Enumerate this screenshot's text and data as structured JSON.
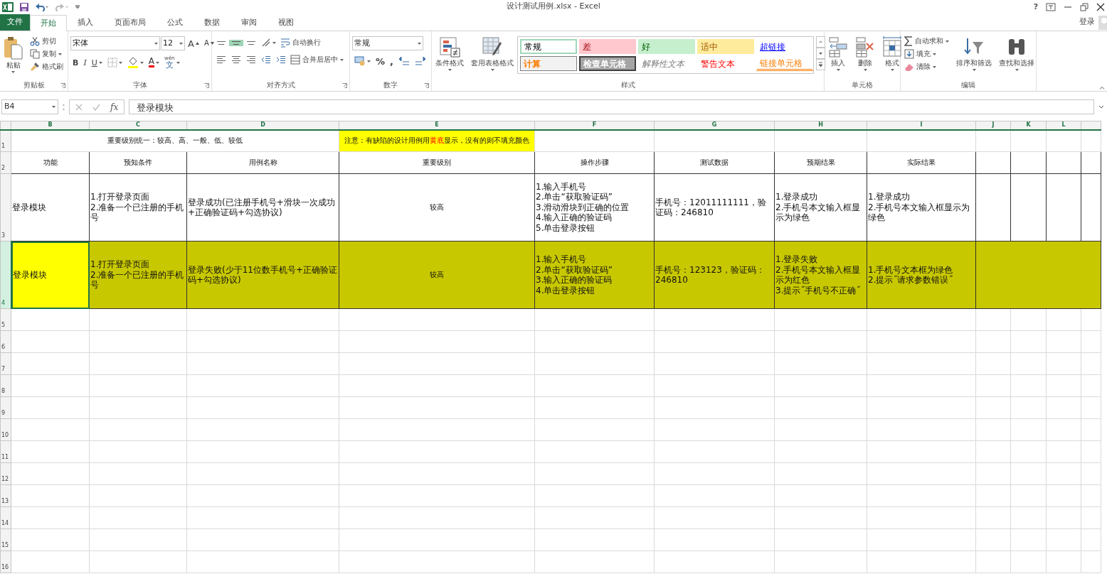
{
  "window": {
    "title": "设计测试用例.xlsx - Excel",
    "help": "?",
    "login": "登录"
  },
  "ribbon_tabs": [
    {
      "label": "文件",
      "kind": "file",
      "selected": false
    },
    {
      "label": "开始",
      "kind": "tab",
      "selected": true
    },
    {
      "label": "插入",
      "kind": "tab",
      "selected": false
    },
    {
      "label": "页面布局",
      "kind": "tab",
      "selected": false
    },
    {
      "label": "公式",
      "kind": "tab",
      "selected": false
    },
    {
      "label": "数据",
      "kind": "tab",
      "selected": false
    },
    {
      "label": "审阅",
      "kind": "tab",
      "selected": false
    },
    {
      "label": "视图",
      "kind": "tab",
      "selected": false
    }
  ],
  "ribbon_groups": [
    {
      "label": "剪贴板",
      "stacks": [
        [
          {
            "kind": "paste",
            "label": "粘贴"
          }
        ],
        [
          {
            "kind": "cut",
            "label": "剪切"
          },
          {
            "kind": "copy",
            "label": "复制"
          },
          {
            "kind": "brush",
            "label": "格式刷"
          }
        ]
      ]
    },
    {
      "label": "字体",
      "lines": [
        [
          {
            "kind": "combo",
            "value": "宋体"
          },
          {
            "kind": "combo",
            "value": "12"
          },
          {
            "kind": "grow",
            "label": "A"
          },
          {
            "kind": "shrink",
            "label": "A"
          }
        ],
        [
          {
            "kind": "bold",
            "label": "B"
          },
          {
            "kind": "italic",
            "label": "I"
          },
          {
            "kind": "underline",
            "label": "U"
          },
          {
            "kind": "border"
          },
          {
            "kind": "fill"
          },
          {
            "kind": "fontcolor",
            "label": "A"
          },
          {
            "kind": "phonetic",
            "label": "文",
            "ruby": "wén"
          }
        ]
      ]
    },
    {
      "label": "对齐方式",
      "lines": [
        [
          {
            "kind": "align-top",
            "selected": false
          },
          {
            "kind": "align-middle",
            "selected": true
          },
          {
            "kind": "align-bottom",
            "selected": false
          },
          {
            "kind": "orient"
          },
          {
            "kind": "wrap",
            "label": "自动换行"
          }
        ],
        [
          {
            "kind": "align-left",
            "selected": false
          },
          {
            "kind": "align-center",
            "selected": false
          },
          {
            "kind": "align-right",
            "selected": false
          },
          {
            "kind": "outdent"
          },
          {
            "kind": "indent"
          },
          {
            "kind": "merge",
            "label": "合并后居中"
          }
        ]
      ]
    },
    {
      "label": "数字",
      "lines": [
        [
          {
            "kind": "combo",
            "value": "常规"
          }
        ],
        [
          {
            "kind": "accounting"
          },
          {
            "kind": "percent",
            "label": "%"
          },
          {
            "kind": "comma",
            "label": ","
          },
          {
            "kind": "inc-decimal"
          },
          {
            "kind": "dec-decimal"
          }
        ]
      ]
    },
    {
      "label": "样式",
      "stacks": [
        [
          {
            "kind": "condfmt",
            "label": "条件格式"
          }
        ],
        [
          {
            "kind": "tablefmt",
            "label": "套用表格格式"
          }
        ],
        [
          {
            "kind": "gallery",
            "styles": [
              {
                "label": "常规",
                "kind": "normal",
                "selected": true
              },
              {
                "label": "差",
                "kind": "bad",
                "selected": false
              },
              {
                "label": "好",
                "kind": "good",
                "selected": false
              },
              {
                "label": "适中",
                "kind": "neutral",
                "selected": false
              },
              {
                "label": "超链接",
                "kind": "hyperlink",
                "selected": false
              },
              {
                "label": "计算",
                "kind": "calc",
                "selected": false
              },
              {
                "label": "检查单元格",
                "kind": "check",
                "selected": false
              },
              {
                "label": "解释性文本",
                "kind": "explain",
                "selected": false
              },
              {
                "label": "警告文本",
                "kind": "warn",
                "selected": false
              },
              {
                "label": "链接单元格",
                "kind": "linked",
                "selected": false
              }
            ]
          }
        ]
      ]
    },
    {
      "label": "单元格",
      "stacks": [
        [
          {
            "kind": "insert",
            "label": "插入"
          }
        ],
        [
          {
            "kind": "delete",
            "label": "删除"
          }
        ],
        [
          {
            "kind": "format",
            "label": "格式"
          }
        ]
      ]
    },
    {
      "label": "编辑",
      "stacks": [
        [
          {
            "kind": "sum",
            "label": "自动求和"
          },
          {
            "kind": "filldown",
            "label": "填充"
          },
          {
            "kind": "clear",
            "label": "清除"
          }
        ],
        [
          {
            "kind": "sort",
            "label": "排序和筛选"
          }
        ],
        [
          {
            "kind": "find",
            "label": "查找和选择"
          }
        ]
      ]
    }
  ],
  "formula_bar": {
    "name_box": "B4",
    "function_label": "fx",
    "formula": "登录模块"
  },
  "sheet": {
    "columns": [
      "B",
      "C",
      "D",
      "E",
      "F",
      "G",
      "H",
      "I",
      "J",
      "K",
      "L"
    ],
    "rows": [
      {
        "header": "1",
        "kind": "banner",
        "label": "重要级别统一：较高、高、一般、低、较低",
        "note": "注意：有缺陷的设计用例用**黄底**显示，没有的则不填充颜色"
      },
      {
        "header": "2",
        "kind": "heading",
        "cells": [
          "功能",
          "预知条件",
          "用例名称",
          "重要级别",
          "操作步骤",
          "测试数据",
          "预期结果",
          "实际结果"
        ]
      },
      {
        "header": "3",
        "kind": "case",
        "highlighted": false,
        "selected": false,
        "cells": [
          {
            "text": "登录模块",
            "active": false
          },
          {
            "text": "1.打开登录页面\n2.准备一个已注册的手机号",
            "active": false
          },
          {
            "text": "登录成功(已注册手机号+滑块一次成功+正确验证码+勾选协议)",
            "active": false
          },
          {
            "text": "较高",
            "active": false
          },
          {
            "text": "1.输入手机号\n2.单击“获取验证码”\n3.滑动滑块到正确的位置\n4.输入正确的验证码\n5.单击登录按钮",
            "active": false
          },
          {
            "text": "手机号：12011111111，验证码：246810",
            "active": false
          },
          {
            "text": "1.登录成功\n2.手机号本文输入框显示为绿色",
            "active": false
          },
          {
            "text": "1.登录成功\n2.手机号本文输入框显示为绿色",
            "active": false
          }
        ]
      },
      {
        "header": "4",
        "kind": "case",
        "highlighted": true,
        "selected": true,
        "cells": [
          {
            "text": "登录模块",
            "active": true
          },
          {
            "text": "1.打开登录页面\n2.准备一个已注册的手机号",
            "active": false
          },
          {
            "text": "登录失败(少于11位数手机号+正确验证码+勾选协议)",
            "active": false
          },
          {
            "text": "较高",
            "active": false
          },
          {
            "text": "1.输入手机号\n2.单击“获取验证码”\n3.输入正确的验证码\n4.单击登录按钮",
            "active": false
          },
          {
            "text": "手机号：123123，验证码：246810",
            "active": false
          },
          {
            "text": "1.登录失败\n2.手机号本文输入框显示为红色\n3.提示˝手机号不正确˝",
            "active": false
          },
          {
            "text": "1.手机号文本框为绿色\n2.提示˝请求参数错误˝",
            "active": false
          }
        ]
      },
      {
        "header": "5",
        "kind": "empty"
      },
      {
        "header": "6",
        "kind": "empty"
      },
      {
        "header": "7",
        "kind": "empty"
      },
      {
        "header": "8",
        "kind": "empty"
      },
      {
        "header": "9",
        "kind": "empty"
      },
      {
        "header": "10",
        "kind": "empty"
      },
      {
        "header": "11",
        "kind": "empty"
      },
      {
        "header": "12",
        "kind": "empty"
      },
      {
        "header": "13",
        "kind": "empty"
      },
      {
        "header": "14",
        "kind": "empty"
      },
      {
        "header": "15",
        "kind": "empty"
      },
      {
        "header": "16",
        "kind": "empty"
      }
    ]
  }
}
